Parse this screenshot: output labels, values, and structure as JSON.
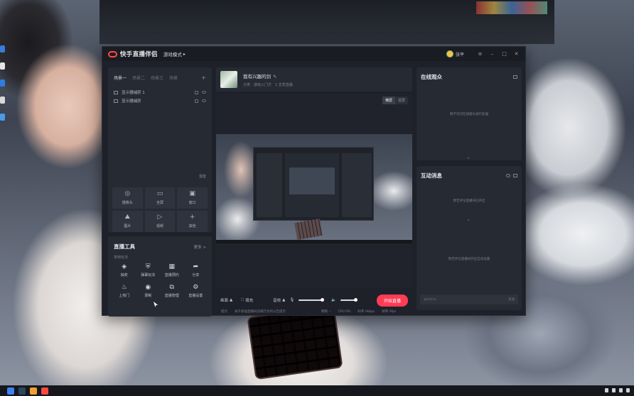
{
  "app": {
    "name": "快手直播伴侣",
    "mode": "游戏模式",
    "username": "张平"
  },
  "scenes": {
    "tabs": [
      "场景一",
      "场景二",
      "场景三",
      "场景"
    ],
    "items": [
      "显示器捕获 1",
      "显示器捕获"
    ],
    "mix_label": "混音"
  },
  "sources": [
    {
      "icon": "camera-icon",
      "glyph": "◎",
      "label": "摄像头"
    },
    {
      "icon": "fullscreen-icon",
      "glyph": "▭",
      "label": "全屏"
    },
    {
      "icon": "window-icon",
      "glyph": "▣",
      "label": "窗口"
    },
    {
      "icon": "image-icon",
      "glyph": "⛰",
      "label": "图片"
    },
    {
      "icon": "video-icon",
      "glyph": "▷",
      "label": "视频"
    },
    {
      "icon": "plus-icon",
      "glyph": "+",
      "label": "其他"
    }
  ],
  "tools": {
    "title": "直播工具",
    "more": "更多 >",
    "subtitle": "常用玩法",
    "items": [
      {
        "icon": "lottery-icon",
        "glyph": "◈",
        "label": "抽奖"
      },
      {
        "icon": "shield-icon",
        "glyph": "⛨",
        "label": "弹幕玩法"
      },
      {
        "icon": "calendar-icon",
        "glyph": "▦",
        "label": "直播预约"
      },
      {
        "icon": "share-icon",
        "glyph": "➦",
        "label": "分享"
      },
      {
        "icon": "hot-icon",
        "glyph": "♨",
        "label": "上热门"
      },
      {
        "icon": "record-icon",
        "glyph": "◉",
        "label": "录制"
      },
      {
        "icon": "manage-icon",
        "glyph": "⧉",
        "label": "直播管理"
      },
      {
        "icon": "settings-icon",
        "glyph": "⚙",
        "label": "直播设置"
      }
    ]
  },
  "room": {
    "title": "我有兴趣的剑",
    "meta": [
      "分类",
      "游戏入门方",
      "1 恋爱直播"
    ]
  },
  "orientation": {
    "landscape": "横屏",
    "portrait": "竖屏"
  },
  "controls": {
    "scene": "画面",
    "fill": "填充",
    "audio": "音效",
    "go_live": "开始直播"
  },
  "viewers": {
    "title": "在线观众",
    "empty": "暂不可对在线观众进行处理"
  },
  "chat": {
    "title": "互动消息",
    "empty1": "暂无评论直播间已开启",
    "empty2": "暂无评论直播间开启互动设置",
    "placeholder": "说点什么",
    "send": "发送"
  },
  "statusbar": {
    "left": "提示",
    "notice": "关于加强直播间违规行为的公告提示",
    "items": [
      "网络 --",
      "CPU 0%",
      "码率 0kbps",
      "帧率 0fps"
    ]
  }
}
